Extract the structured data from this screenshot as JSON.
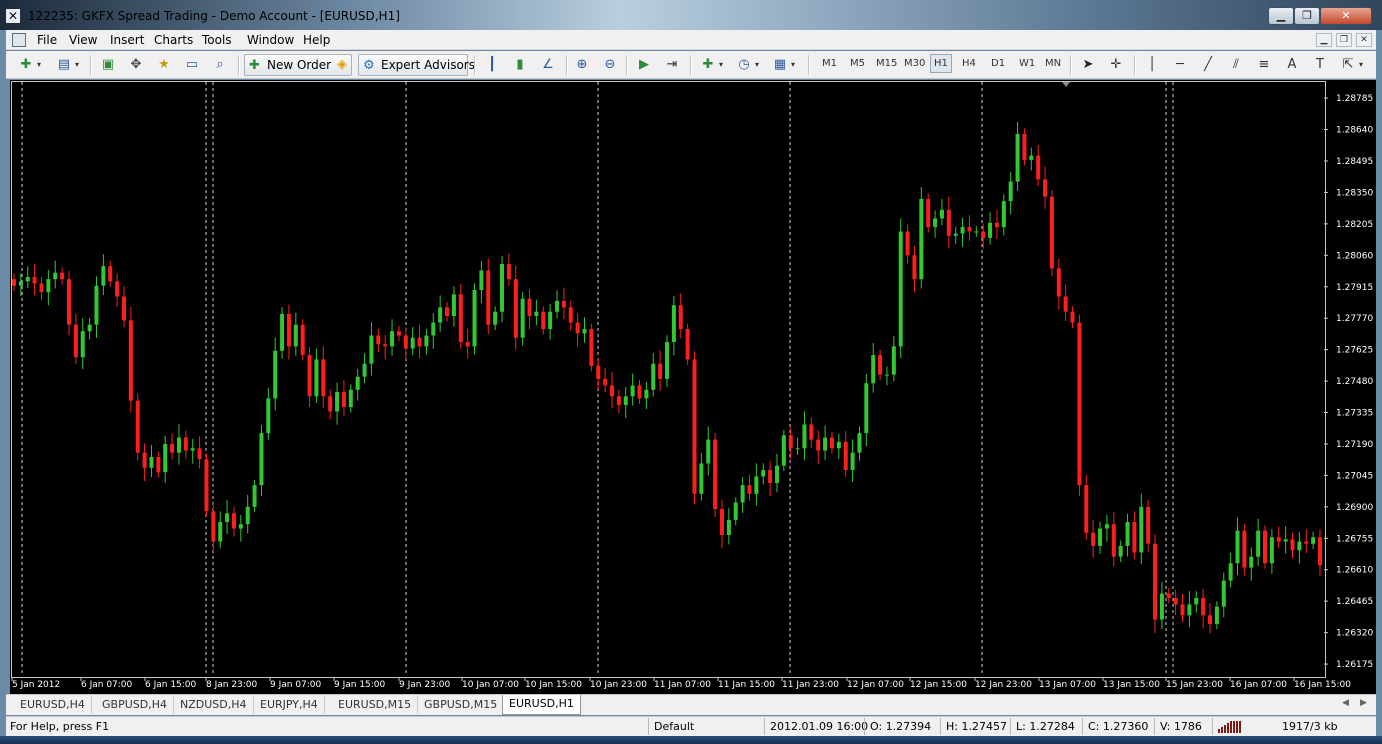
{
  "window": {
    "title": "122235: GKFX Spread Trading - Demo Account - [EURUSD,H1]",
    "icon": "mt4-x-icon"
  },
  "menu": {
    "items": [
      "File",
      "View",
      "Insert",
      "Charts",
      "Tools",
      "Window",
      "Help"
    ]
  },
  "toolbar": {
    "new_order_label": "New Order",
    "expert_advisors_label": "Expert Advisors",
    "timeframes": [
      "M1",
      "M5",
      "M15",
      "M30",
      "H1",
      "H4",
      "D1",
      "W1",
      "MN"
    ],
    "active_timeframe": "H1"
  },
  "chart_data": {
    "type": "candlestick",
    "symbol": "EURUSD",
    "timeframe": "H1",
    "background": "#000000",
    "bull_color": "#32c832",
    "bear_color": "#ff1e1e",
    "ylim": [
      1.2612,
      1.2885
    ],
    "y_ticks": [
      "1.28785",
      "1.28640",
      "1.28495",
      "1.28350",
      "1.28205",
      "1.28060",
      "1.27915",
      "1.27770",
      "1.27625",
      "1.27480",
      "1.27335",
      "1.27190",
      "1.27045",
      "1.26900",
      "1.26755",
      "1.26610",
      "1.26465",
      "1.26320",
      "1.26175"
    ],
    "x_ticks": [
      "5 Jan 2012",
      "6 Jan 07:00",
      "6 Jan 15:00",
      "8 Jan 23:00",
      "9 Jan 07:00",
      "9 Jan 15:00",
      "9 Jan 23:00",
      "10 Jan 07:00",
      "10 Jan 15:00",
      "10 Jan 23:00",
      "11 Jan 07:00",
      "11 Jan 15:00",
      "11 Jan 23:00",
      "12 Jan 07:00",
      "12 Jan 15:00",
      "12 Jan 23:00",
      "13 Jan 07:00",
      "13 Jan 15:00",
      "15 Jan 23:00",
      "16 Jan 07:00",
      "16 Jan 15:00"
    ],
    "close": [
      1.2792,
      1.2794,
      1.2796,
      1.2793,
      1.2789,
      1.2795,
      1.2798,
      1.2795,
      1.2774,
      1.2759,
      1.2771,
      1.2774,
      1.2792,
      1.2801,
      1.2794,
      1.2787,
      1.2776,
      1.2739,
      1.2715,
      1.2708,
      1.2713,
      1.2706,
      1.2719,
      1.2715,
      1.2722,
      1.2716,
      1.2717,
      1.2712,
      1.2688,
      1.2674,
      1.2683,
      1.2687,
      1.268,
      1.2682,
      1.269,
      1.27,
      1.2724,
      1.274,
      1.2762,
      1.2779,
      1.2764,
      1.2774,
      1.276,
      1.2741,
      1.2758,
      1.2741,
      1.2734,
      1.2743,
      1.2736,
      1.2744,
      1.275,
      1.2756,
      1.2769,
      1.2765,
      1.2764,
      1.2771,
      1.2769,
      1.2763,
      1.2768,
      1.2764,
      1.2769,
      1.2775,
      1.2782,
      1.2778,
      1.2788,
      1.2766,
      1.2764,
      1.279,
      1.2799,
      1.2774,
      1.278,
      1.2802,
      1.2795,
      1.2768,
      1.2786,
      1.2778,
      1.278,
      1.2772,
      1.278,
      1.2785,
      1.2782,
      1.2775,
      1.277,
      1.2772,
      1.2755,
      1.2749,
      1.2746,
      1.2741,
      1.2737,
      1.2741,
      1.2746,
      1.274,
      1.2744,
      1.2756,
      1.2749,
      1.2766,
      1.2783,
      1.2772,
      1.2758,
      1.2696,
      1.271,
      1.2721,
      1.2689,
      1.2677,
      1.2684,
      1.2692,
      1.27,
      1.2696,
      1.2704,
      1.2707,
      1.2701,
      1.2709,
      1.2723,
      1.2717,
      1.2717,
      1.2728,
      1.2721,
      1.2716,
      1.2722,
      1.2717,
      1.272,
      1.2707,
      1.2715,
      1.2724,
      1.2747,
      1.276,
      1.2751,
      1.2751,
      1.2764,
      1.2817,
      1.2806,
      1.2795,
      1.2832,
      1.2819,
      1.2823,
      1.2827,
      1.2815,
      1.2816,
      1.2819,
      1.2817,
      1.2817,
      1.2814,
      1.2821,
      1.2819,
      1.2831,
      1.284,
      1.2862,
      1.285,
      1.2852,
      1.2841,
      1.2833,
      1.28,
      1.2787,
      1.278,
      1.2775,
      1.27,
      1.2678,
      1.2672,
      1.268,
      1.2682,
      1.2667,
      1.2672,
      1.2683,
      1.2669,
      1.269,
      1.2673,
      1.2638,
      1.265,
      1.2648,
      1.2645,
      1.264,
      1.2645,
      1.2648,
      1.264,
      1.2636,
      1.2644,
      1.2656,
      1.2664,
      1.2679,
      1.2662,
      1.2667,
      1.2679,
      1.2664,
      1.2676,
      1.2674,
      1.2675,
      1.267,
      1.2674,
      1.2673,
      1.2676,
      1.2663
    ]
  },
  "tabs": {
    "items": [
      "EURUSD,H4",
      "GBPUSD,H4",
      "NZDUSD,H4",
      "EURJPY,H4",
      "EURUSD,M15",
      "GBPUSD,M15",
      "EURUSD,H1"
    ],
    "active": "EURUSD,H1"
  },
  "status": {
    "help": "For Help, press F1",
    "profile": "Default",
    "datetime": "2012.01.09 16:00",
    "open": "O: 1.27394",
    "high": "H: 1.27457",
    "low": "L: 1.27284",
    "close": "C: 1.27360",
    "volume": "V: 1786",
    "traffic": "1917/3 kb"
  }
}
